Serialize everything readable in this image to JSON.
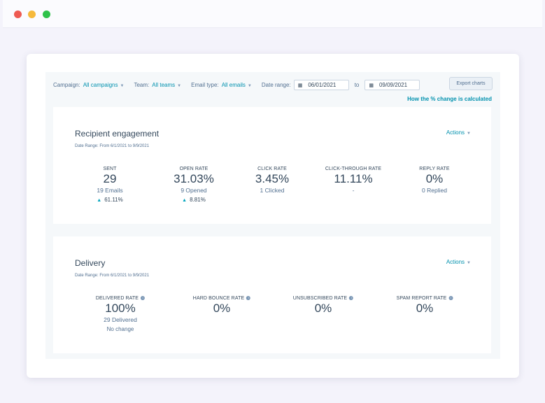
{
  "window": {
    "dot_colors": [
      "#ee5a52",
      "#f6b93b",
      "#2fc24a"
    ]
  },
  "filters": {
    "campaign_label": "Campaign:",
    "campaign_value": "All campaigns",
    "team_label": "Team:",
    "team_value": "All teams",
    "email_type_label": "Email type:",
    "email_type_value": "All emails",
    "date_range_label": "Date range:",
    "start_date": "06/01/2021",
    "to_label": "to",
    "end_date": "09/09/2021",
    "export_label": "Export charts",
    "change_link": "How the % change is calculated"
  },
  "engagement": {
    "title": "Recipient engagement",
    "range": "Date Range: From 6/1/2021 to 9/9/2021",
    "actions": "Actions",
    "stats": [
      {
        "label": "SENT",
        "value": "29",
        "sub": "19 Emails",
        "change": "61.11%",
        "trend": "up"
      },
      {
        "label": "OPEN RATE",
        "value": "31.03%",
        "sub": "9 Opened",
        "change": "8.81%",
        "trend": "up"
      },
      {
        "label": "CLICK RATE",
        "value": "3.45%",
        "sub": "1 Clicked"
      },
      {
        "label": "CLICK-THROUGH RATE",
        "value": "11.11%",
        "sub": "-"
      },
      {
        "label": "REPLY RATE",
        "value": "0%",
        "sub": "0 Replied"
      }
    ]
  },
  "delivery": {
    "title": "Delivery",
    "range": "Date Range: From 6/1/2021 to 9/9/2021",
    "actions": "Actions",
    "stats": [
      {
        "label": "DELIVERED RATE",
        "value": "100%",
        "sub": "29 Delivered",
        "change": "No change"
      },
      {
        "label": "HARD BOUNCE RATE",
        "value": "0%"
      },
      {
        "label": "UNSUBSCRIBED RATE",
        "value": "0%"
      },
      {
        "label": "SPAM REPORT RATE",
        "value": "0%"
      }
    ]
  }
}
